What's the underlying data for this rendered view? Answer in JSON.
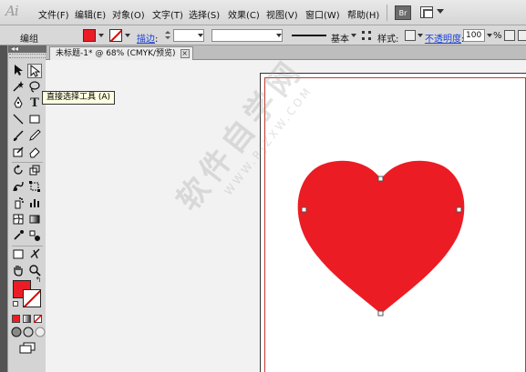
{
  "app": {
    "logo": "Ai"
  },
  "menu": {
    "items": [
      {
        "label": "文件(F)"
      },
      {
        "label": "编辑(E)"
      },
      {
        "label": "对象(O)"
      },
      {
        "label": "文字(T)"
      },
      {
        "label": "选择(S)"
      },
      {
        "label": "效果(C)"
      },
      {
        "label": "视图(V)"
      },
      {
        "label": "窗口(W)"
      },
      {
        "label": "帮助(H)"
      }
    ],
    "bridge_label": "Br"
  },
  "control": {
    "selection_label": "编组",
    "stroke_link": "描边",
    "stroke_colon": ":",
    "stroke_style": "基本",
    "style_label": "样式:",
    "opacity_link": "不透明度",
    "opacity_colon": ":",
    "opacity_value": "100",
    "opacity_unit": "%"
  },
  "document": {
    "tab_title": "未标题-1* @ 68% (CMYK/预览)",
    "close": "×"
  },
  "tooltip": {
    "text": "直接选择工具 (A)"
  },
  "watermark": {
    "main": "软件自学网",
    "url": "WWW.RJZXW.COM"
  },
  "colors": {
    "fill": "#ec1c24",
    "heart": "#ec1c24",
    "accent_link": "#1a3fd6"
  },
  "toolbox": {
    "collapse": "◂◂",
    "tools": [
      "selection-tool-icon",
      "direct-selection-tool-icon",
      "magic-wand-tool-icon",
      "lasso-tool-icon",
      "pen-tool-icon",
      "type-tool-icon",
      "line-tool-icon",
      "rectangle-tool-icon",
      "paintbrush-tool-icon",
      "pencil-tool-icon",
      "blob-brush-tool-icon",
      "eraser-tool-icon",
      "rotate-tool-icon",
      "scale-tool-icon",
      "warp-tool-icon",
      "free-transform-tool-icon",
      "symbol-sprayer-tool-icon",
      "column-graph-tool-icon",
      "mesh-tool-icon",
      "gradient-tool-icon",
      "eyedropper-tool-icon",
      "blend-tool-icon",
      "slice-tool-icon",
      "scissors-tool-icon",
      "hand-tool-icon",
      "zoom-tool-icon"
    ],
    "type_glyph": "T"
  }
}
